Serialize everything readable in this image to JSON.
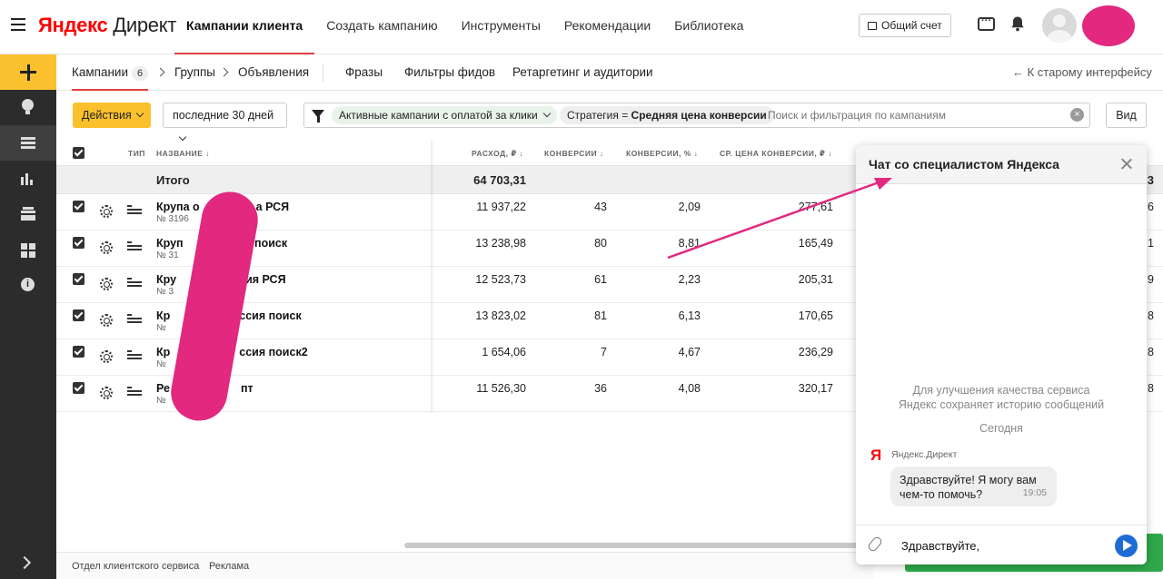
{
  "header": {
    "logo_ya": "Яндекс",
    "logo_rest": "Директ",
    "nav": [
      "Кампании клиента",
      "Создать кампанию",
      "Инструменты",
      "Рекомендации",
      "Библиотека"
    ],
    "account_button": "Общий счет"
  },
  "subnav": {
    "campaigns": "Кампании",
    "campaigns_count": "6",
    "groups": "Группы",
    "ads": "Объявления",
    "phrases": "Фразы",
    "feed_filters": "Фильтры фидов",
    "retargeting": "Ретаргетинг и аудитории",
    "back_link": "← К старому интерфейсу"
  },
  "toolbar": {
    "actions": "Действия",
    "period": "последние 30 дней",
    "chip_active": "Активные кампании с оплатой за клики",
    "chip_strategy_label": "Стратегия = ",
    "chip_strategy_value": "Средняя цена конверсии",
    "search_placeholder": "Поиск и фильтрация по кампаниям",
    "view": "Вид"
  },
  "table": {
    "headers": {
      "type": "ТИП",
      "name": "НАЗВАНИЕ ↓",
      "spend": "РАСХОД, ₽ ↓",
      "conversions": "КОНВЕРСИИ ↓",
      "conv_rate": "КОНВЕРСИИ, % ↓",
      "avg_cost": "СР. ЦЕНА КОНВЕРСИИ, ₽ ↓"
    },
    "total_label": "Итого",
    "total_spend": "64 703,31",
    "rows": [
      {
        "name": "Крупа о",
        "name_tail": "а РСЯ",
        "num": "№ 3196",
        "spend": "11 937,22",
        "conv": "43",
        "rate": "2,09",
        "cost": "277,61",
        "edge": "6"
      },
      {
        "name": "Круп",
        "name_tail": "а поиск",
        "num": "№ 31",
        "spend": "13 238,98",
        "conv": "80",
        "rate": "8,81",
        "cost": "165,49",
        "edge": "1"
      },
      {
        "name": "Кру",
        "name_tail": "ия РСЯ",
        "num": "№ 3",
        "spend": "12 523,73",
        "conv": "61",
        "rate": "2,23",
        "cost": "205,31",
        "edge": "9"
      },
      {
        "name": "Кр",
        "name_tail": "ссия поиск",
        "num": "№",
        "spend": "13 823,02",
        "conv": "81",
        "rate": "6,13",
        "cost": "170,65",
        "edge": "8"
      },
      {
        "name": "Кр",
        "name_tail": "ссия поиск2",
        "num": "№",
        "spend": "1 654,06",
        "conv": "7",
        "rate": "4,67",
        "cost": "236,29",
        "edge": "8"
      },
      {
        "name": "Ре",
        "name_tail": "пт",
        "num": "№",
        "spend": "11 526,30",
        "conv": "36",
        "rate": "4,08",
        "cost": "320,17",
        "edge": "8"
      }
    ],
    "total_edge": "3"
  },
  "footer": {
    "service": "Отдел клиентского сервиса",
    "ads": "Реклама"
  },
  "chat": {
    "title": "Чат со специалистом Яндекса",
    "note_line1": "Для улучшения качества сервиса",
    "note_line2": "Яндекс сохраняет историю сообщений",
    "day": "Сегодня",
    "ya_letter": "Я",
    "sender": "Яндекс.Директ",
    "message_line1": "Здравствуйте! Я могу вам",
    "message_line2": "чем-то помочь?",
    "time": "19:05",
    "input_value": "Здравствуйте,"
  },
  "colors": {
    "accent_yellow": "#fbc02d",
    "active_tab_red": "#e24040",
    "annotation_pink": "#e2287f",
    "send_blue": "#1e6bd6",
    "green_button": "#2ea84a"
  }
}
